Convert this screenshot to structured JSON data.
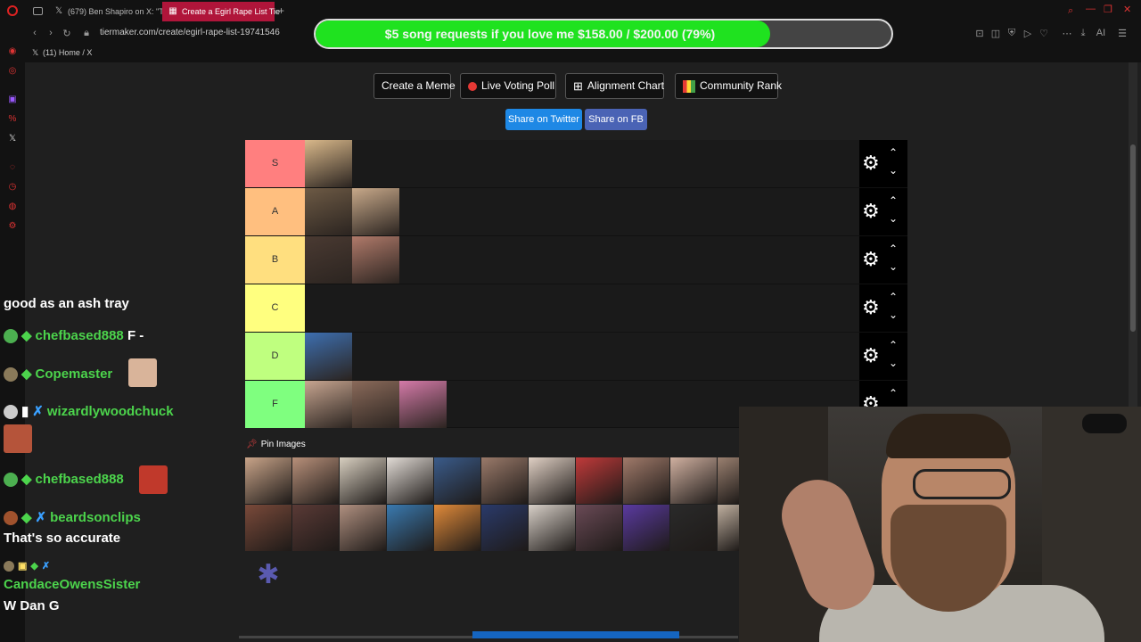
{
  "browser": {
    "tabs": [
      {
        "label": "(679) Ben Shapiro on X: \"T",
        "icon": "x-logo-icon",
        "active": false
      },
      {
        "label": "Create a Egirl Rape List Tie",
        "icon": "tiermaker-icon",
        "active": true
      }
    ],
    "new_tab": "+",
    "url": "tiermaker.com/create/egirl-rape-list-19741546",
    "bookmark": "(11) Home / X"
  },
  "donation": {
    "text": "$5 song requests if you love me $158.00 / $200.00 (79%)",
    "progress": 0.79,
    "fill_color": "#1fe21f"
  },
  "toolbar": {
    "create_meme": "Create a Meme",
    "live_voting": "Live Voting Poll",
    "alignment_chart": "Alignment Chart",
    "community_rank": "Community Rank",
    "share_twitter": "Share on Twitter",
    "share_fb": "Share on FB",
    "twitter_color": "#1e88e5",
    "fb_color": "#4a63b5"
  },
  "tiers": [
    {
      "label": "S",
      "color": "#ff7f7f",
      "items": 1
    },
    {
      "label": "A",
      "color": "#ffbf7f",
      "items": 2
    },
    {
      "label": "B",
      "color": "#ffdf7f",
      "items": 2
    },
    {
      "label": "C",
      "color": "#ffff7f",
      "items": 0
    },
    {
      "label": "D",
      "color": "#bfff7f",
      "items": 1
    },
    {
      "label": "F",
      "color": "#7fff7f",
      "items": 3
    }
  ],
  "pin_images": "Pin Images",
  "chat": [
    {
      "user": "",
      "text": "good as an ash tray"
    },
    {
      "user": "chefbased888",
      "text": "F -"
    },
    {
      "user": "Copemaster",
      "text": ""
    },
    {
      "user": "wizardlywoodchuck",
      "text": ""
    },
    {
      "user": "chefbased888",
      "text": ""
    },
    {
      "user": "beardsonclips",
      "text": ""
    },
    {
      "user": "",
      "text": "That's so accurate"
    },
    {
      "user": "CandaceOwensSister",
      "text": ""
    },
    {
      "user": "",
      "text": "W Dan G"
    }
  ]
}
